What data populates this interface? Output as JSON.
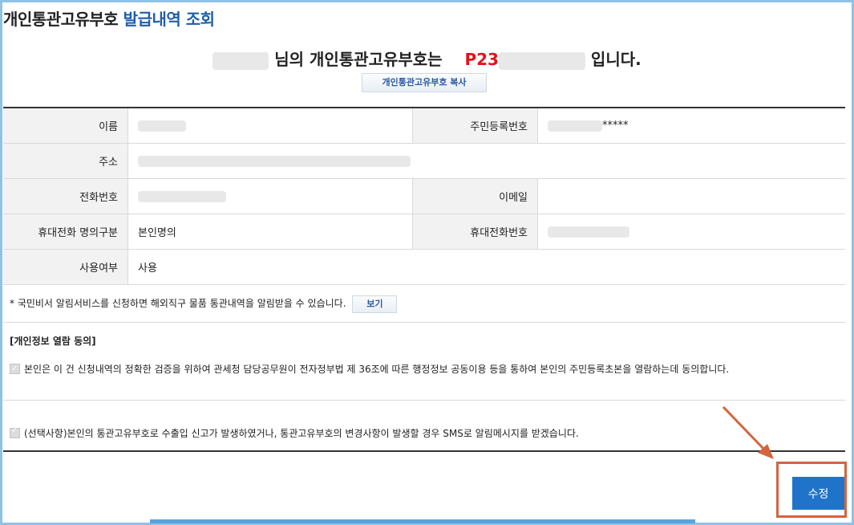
{
  "header": {
    "title_black": "개인통관고유부호",
    "title_blue": "발급내역 조회"
  },
  "headline": {
    "suffix1": "님의 개인통관고유부호는",
    "code_prefix": "P23",
    "suffix2": "입니다."
  },
  "copy_button": "개인통관고유부호 복사",
  "info": {
    "name_label": "이름",
    "rrn_label": "주민등록번호",
    "rrn_tail": "*****",
    "address_label": "주소",
    "phone_label": "전화번호",
    "email_label": "이메일",
    "mobile_owner_label": "휴대전화 명의구분",
    "mobile_owner_value": "본인명의",
    "mobile_label": "휴대전화번호",
    "usage_label": "사용여부",
    "usage_value": "사용"
  },
  "notice": {
    "text": "* 국민비서 알림서비스를 신청하면 해외직구 물품 통관내역을 알림받을 수 있습니다.",
    "view_button": "보기"
  },
  "consent": {
    "heading": "[개인정보 열람 동의]",
    "item1": "본인은 이 건 신청내역의 정확한 검증을 위하여 관세청 담당공무원이 전자정부법 제 36조에 따른 행정정보 공동이용 등을 통하여 본인의 주민등록초본을 열람하는데 동의합니다.",
    "item2": "(선택사항)본인의 통관고유부호로 수출입 신고가 발생하였거나, 통관고유부호의 변경사항이 발생할 경우 SMS로 알림메시지를 받겠습니다."
  },
  "actions": {
    "edit_button": "수정"
  },
  "colors": {
    "accent_blue": "#1f5fa8",
    "code_red": "#e2141b",
    "button_blue": "#1f74c9",
    "highlight_orange": "#d2653f",
    "frame_blue": "#8fc2e6"
  }
}
